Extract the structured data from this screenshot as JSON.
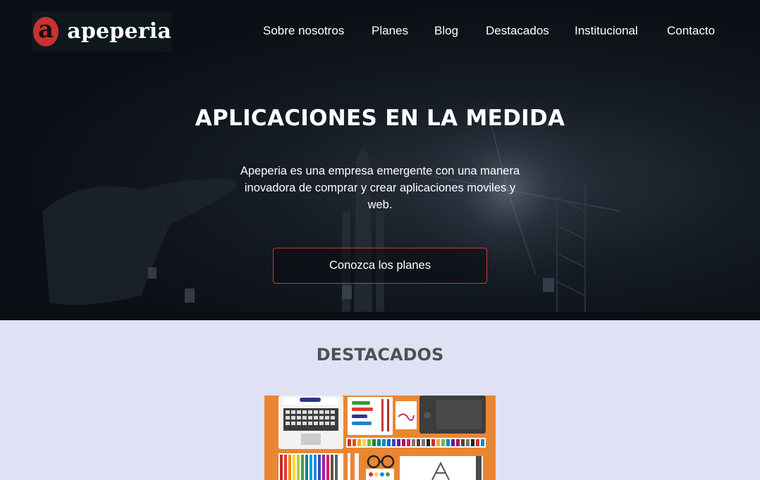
{
  "header": {
    "logo_letter": "a",
    "logo_text": "apeperia",
    "nav": [
      {
        "label": "Sobre nosotros"
      },
      {
        "label": "Planes"
      },
      {
        "label": "Blog"
      },
      {
        "label": "Destacados"
      },
      {
        "label": "Institucional"
      },
      {
        "label": "Contacto"
      }
    ]
  },
  "hero": {
    "title": "APLICACIONES EN LA MEDIDA",
    "description": "Apeperia es una empresa emergente con una manera inovadora de comprar y crear aplicaciones moviles y web.",
    "cta_label": "Conozca los planes"
  },
  "featured": {
    "title": "DESTACADOS",
    "image_icon": "designer-desk-illustration"
  },
  "colors": {
    "brand_red": "#c8322f",
    "section_bg": "#dfe2f5",
    "hero_bg": "#0b0f15",
    "featured_orange": "#ea8631"
  }
}
